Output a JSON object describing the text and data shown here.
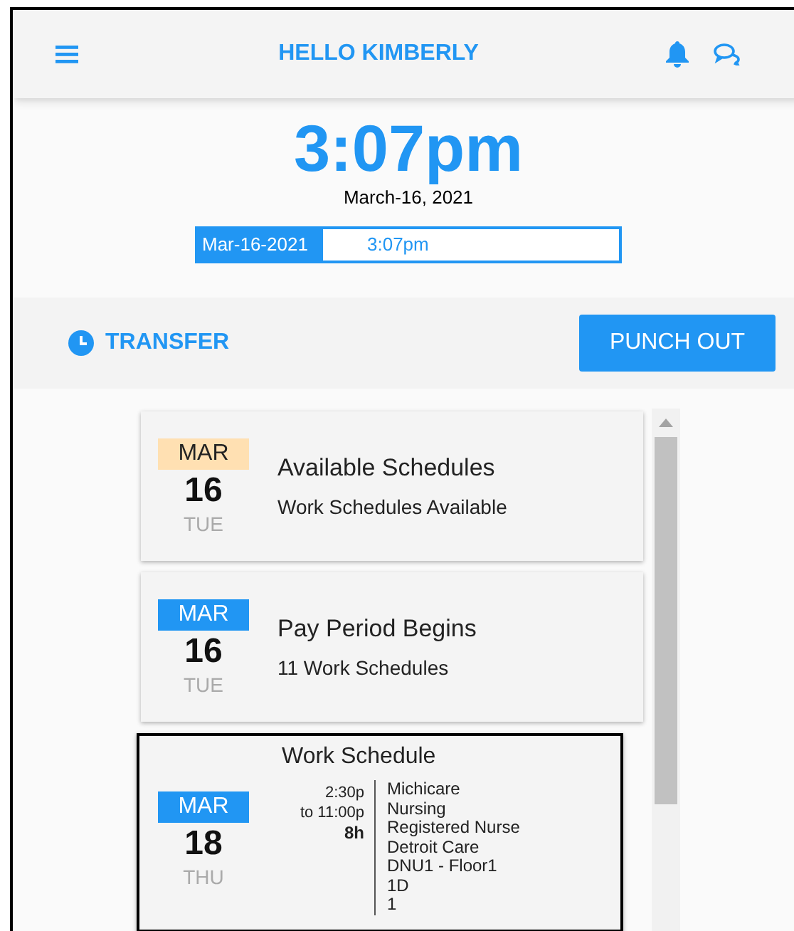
{
  "header": {
    "title": "HELLO KIMBERLY"
  },
  "clock": {
    "time": "3:07pm",
    "date": "March-16, 2021",
    "date_field": "Mar-16-2021",
    "time_field": "3:07pm"
  },
  "actions": {
    "transfer": "TRANSFER",
    "punch_out": "PUNCH OUT"
  },
  "cards": [
    {
      "kind": "event",
      "month": "MAR",
      "day": "16",
      "weekday": "TUE",
      "color": "#ffe0b2",
      "title": "Available Schedules",
      "subtitle": "Work Schedules Available",
      "selected": false
    },
    {
      "kind": "event",
      "month": "MAR",
      "day": "16",
      "weekday": "TUE",
      "color": "#2196f3",
      "title": "Pay Period Begins",
      "subtitle": "11 Work Schedules",
      "selected": false
    },
    {
      "kind": "schedule",
      "month": "MAR",
      "day": "18",
      "weekday": "THU",
      "color": "#2196f3",
      "title": "Work Schedule",
      "start": "2:30p",
      "end": "to 11:00p",
      "hours": "8h",
      "details": [
        "Michicare",
        "Nursing",
        "Registered Nurse",
        "Detroit Care",
        "DNU1 - Floor1",
        "1D",
        "1"
      ],
      "selected": true
    }
  ]
}
